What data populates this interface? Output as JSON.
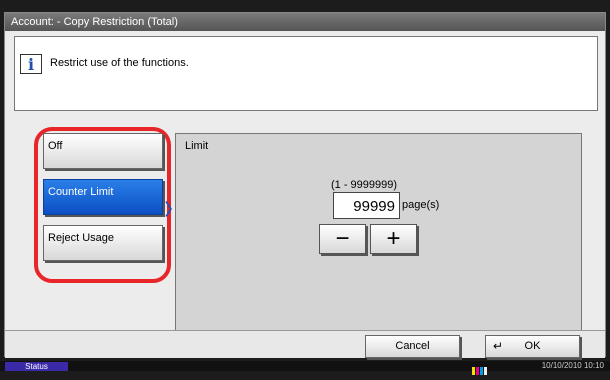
{
  "window": {
    "title": "Account: - Copy Restriction (Total)"
  },
  "message": {
    "text": "Restrict use of the functions.",
    "icon": "info-icon"
  },
  "options": [
    {
      "label": "Off",
      "selected": false
    },
    {
      "label": "Counter Limit",
      "selected": true
    },
    {
      "label": "Reject Usage",
      "selected": false
    }
  ],
  "limit": {
    "title": "Limit",
    "range": "(1 - 9999999)",
    "value": "99999",
    "unit": "page(s)",
    "minus": "−",
    "plus": "+"
  },
  "footer": {
    "cancel": "Cancel",
    "ok": "OK"
  },
  "statusbar": {
    "status": "Status",
    "datetime": "10/10/2010  10:10"
  },
  "colors": {
    "selected": "#0b4fc4",
    "highlight": "#e8262a",
    "titlebar": "#555555"
  }
}
